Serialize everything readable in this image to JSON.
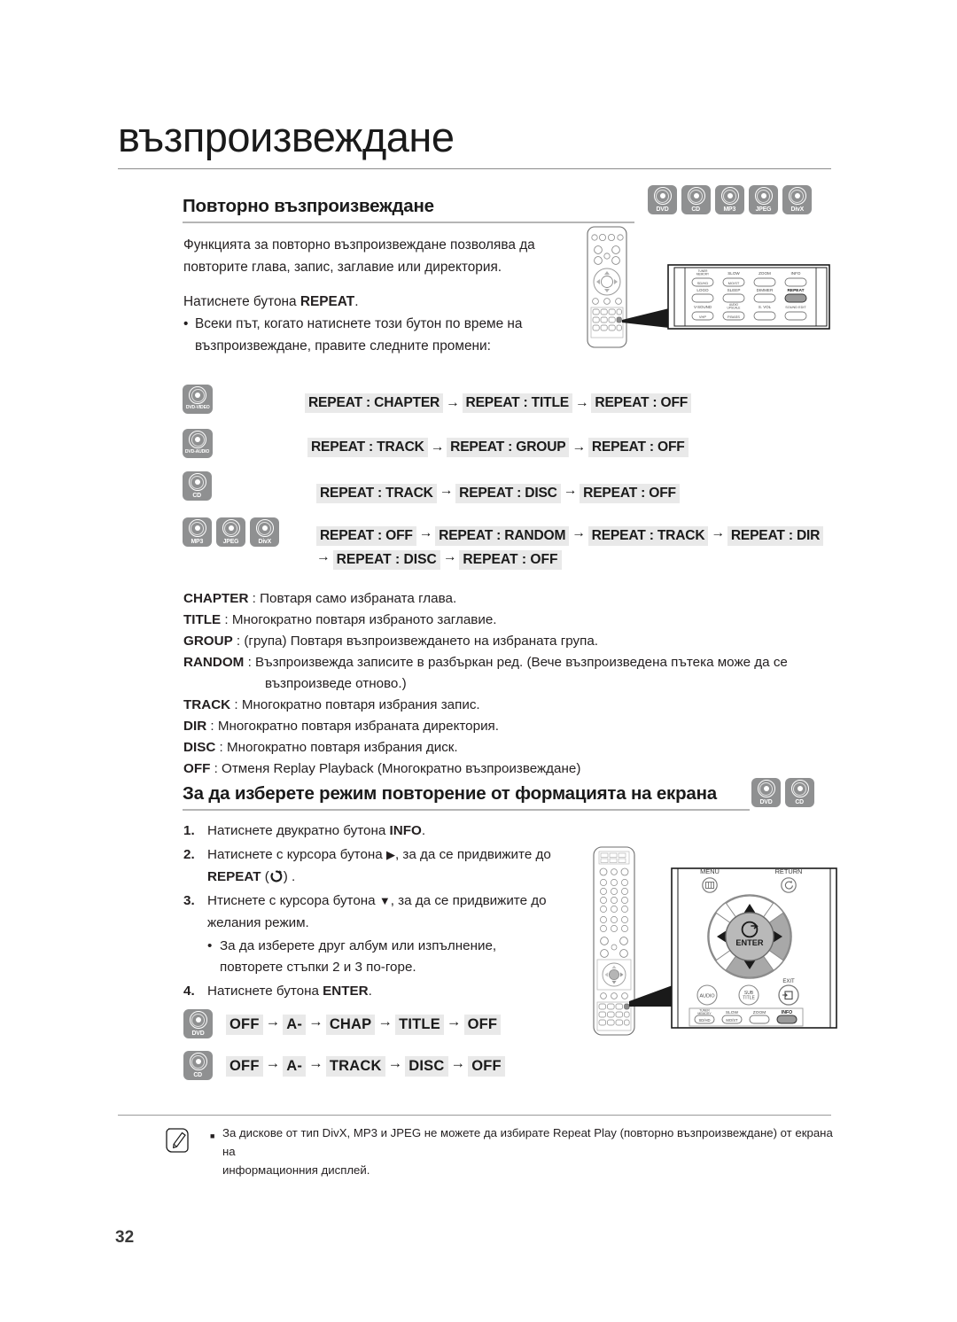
{
  "chapter": {
    "title": "възпроизвеждане"
  },
  "page": {
    "number": "32"
  },
  "section1": {
    "heading": "Повторно възпроизвеждане",
    "badges": [
      "DVD",
      "CD",
      "MP3",
      "JPEG",
      "DivX"
    ],
    "intro_line1": "Функцията за повторно възпроизвеждане позволява да",
    "intro_line2": "повторите глава, запис, заглавие или директория.",
    "press_prefix": "Натиснете бутона ",
    "press_button": "REPEAT",
    "press_suffix": ".",
    "bullet_line1": "Всеки път, когато натиснете този бутон по време на",
    "bullet_line2": "възпроизвеждане, правите следните промени:"
  },
  "sequences": [
    {
      "icons": [
        "DVD-VIDEO"
      ],
      "steps": [
        "REPEAT : CHAPTER",
        "REPEAT : TITLE",
        "REPEAT : OFF"
      ]
    },
    {
      "icons": [
        "DVD-AUDIO"
      ],
      "steps": [
        "REPEAT : TRACK",
        "REPEAT : GROUP",
        "REPEAT : OFF"
      ]
    },
    {
      "icons": [
        "CD"
      ],
      "steps": [
        "REPEAT : TRACK",
        "REPEAT : DISC",
        "REPEAT : OFF"
      ]
    },
    {
      "icons": [
        "MP3",
        "JPEG",
        "DivX"
      ],
      "steps": [
        "REPEAT : OFF",
        "REPEAT : RANDOM",
        "REPEAT : TRACK",
        "REPEAT : DIR"
      ],
      "steps2": [
        "REPEAT : DISC",
        "REPEAT : OFF"
      ]
    }
  ],
  "definitions": [
    {
      "term": "CHAPTER",
      "text": " : Повтаря само избраната глава."
    },
    {
      "term": "TITLE",
      "text": " : Многократно повтаря избраното заглавие."
    },
    {
      "term": "GROUP",
      "text": " : (група) Повтаря възпроизвеждането на избраната група."
    },
    {
      "term": "RANDOM",
      "text": " : Възпроизвежда записите в разбъркан ред. (Вече възпроизведена пътека може да се"
    },
    {
      "term": "",
      "text": "възпроизведе отново.)",
      "continuation": true
    },
    {
      "term": "TRACK",
      "text": " : Многократно повтаря избрания запис."
    },
    {
      "term": "DIR",
      "text": " : Многократно повтаря избраната директория."
    },
    {
      "term": "DISC",
      "text": " : Многократно повтаря избрания диск."
    },
    {
      "term": "OFF",
      "text": " : Отменя Replay Playback (Многократно възпроизвеждане)"
    }
  ],
  "section2": {
    "heading": "За да изберете режим повторение от формацията на екрана",
    "badges": [
      "DVD",
      "CD"
    ],
    "steps": [
      {
        "num": "1.",
        "pre": "Натиснете двукратно бутона ",
        "bold": "INFO",
        "post": "."
      },
      {
        "num": "2.",
        "pre": "Натиснете с курсора бутона ",
        "glyph": "right-arrow-glyph",
        "post": ", за да се придвижите до",
        "line2_bold": "REPEAT",
        "line2_post": " (",
        "line2_end": ") ."
      },
      {
        "num": "3.",
        "pre": "Нтиснете с курсора бутона ",
        "glyph": "down-arrow-glyph",
        "post": ", за да се придвижите до",
        "line2": "желания режим."
      },
      {
        "num": "4.",
        "pre": "Натиснете бутона ",
        "bold": "ENTER",
        "post": "."
      }
    ],
    "sub_bullet_line1": "За да изберете друг албум или изпълнение,",
    "sub_bullet_line2": "повторете стъпки 2 и 3 по-горе."
  },
  "osd_sequences": [
    {
      "icon": "DVD",
      "steps": [
        "OFF",
        "A-",
        "CHAP",
        "TITLE",
        "OFF"
      ]
    },
    {
      "icon": "CD",
      "steps": [
        "OFF",
        "A-",
        "TRACK",
        "DISC",
        "OFF"
      ]
    }
  ],
  "note": {
    "line1": "За дискове от тип DivX, MP3 и JPEG не можете да избирате Repeat Play (повторно възпроизвеждане) от екрана на",
    "line2": "информационния дисплей."
  },
  "illustration_top": {
    "callout_buttons": [
      {
        "top": "TUNER MEMORY",
        "label": "SD/HD",
        "highlighted": false
      },
      {
        "top": "SLOW",
        "label": "MO/ST",
        "highlighted": false
      },
      {
        "top": "ZOOM",
        "label": "",
        "highlighted": false
      },
      {
        "top": "INFO",
        "label": "",
        "highlighted": false
      },
      {
        "top": "LOGO",
        "label": "",
        "highlighted": false
      },
      {
        "top": "SLEEP",
        "label": "",
        "highlighted": false
      },
      {
        "top": "DIMMER",
        "label": "",
        "highlighted": false
      },
      {
        "top": "REPEAT",
        "label": "",
        "highlighted": true
      },
      {
        "top": "V-SOUND",
        "label": "VHP",
        "highlighted": false
      },
      {
        "top": "AUDIO UPSCALE",
        "label": "P.BASS",
        "highlighted": false
      },
      {
        "top": "S. VOL",
        "label": "",
        "highlighted": false
      },
      {
        "top": "SOUND EDIT",
        "label": "",
        "highlighted": false
      }
    ]
  },
  "illustration_bottom": {
    "menu_label": "MENU",
    "return_label": "RETURN",
    "enter_label": "ENTER",
    "exit_label": "EXIT",
    "audio_label": "AUDIO",
    "subtitle_label_1": "SUB",
    "subtitle_label_2": "TITLE",
    "bottom_buttons": [
      {
        "top": "TUNER MEMORY",
        "label": "SD/HD",
        "highlighted": false
      },
      {
        "top": "SLOW",
        "label": "MO/ST",
        "highlighted": false
      },
      {
        "top": "ZOOM",
        "label": "",
        "highlighted": false
      },
      {
        "top": "INFO",
        "label": "",
        "highlighted": true
      }
    ]
  },
  "colors": {
    "badge_gray": "#8f9091",
    "chip_gray": "#e9e9e9",
    "highlight_gray": "#9a9a9a",
    "text": "#231f20"
  }
}
